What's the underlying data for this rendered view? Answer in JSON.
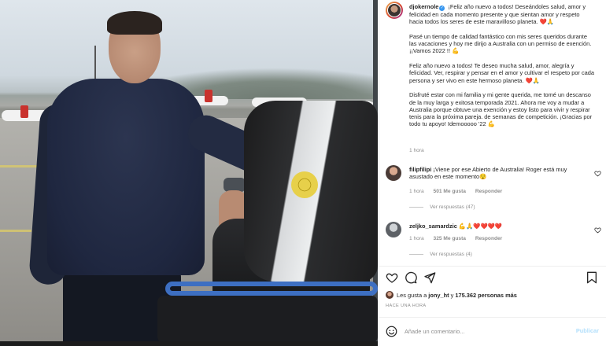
{
  "post": {
    "username": "djokernole",
    "caption_paragraphs": [
      "¡Feliz año nuevo a todos! Deseándoles salud, amor y felicidad en cada momento presente y que sientan amor y respeto hacia todos los seres de este maravilloso planeta. ❤️🙏",
      "Pasé un tiempo de calidad fantástico con mis seres queridos durante las vacaciones y hoy me dirijo a Australia con un permiso de exención. ¡¡Vamos 2022 !! 💪",
      "Feliz año nuevo a todos! Te deseo mucha salud, amor, alegría y felicidad. Ver, respirar y pensar en el amor y cultivar el respeto por cada persona y ser vivo en este hermoso planeta. ❤️🙏",
      "Disfruté estar con mi familia y mi gente querida, me tomé un descanso de la muy larga y exitosa temporada 2021. Ahora me voy a mudar a Australia porque obtuve una exención y estoy listo para vivir y respirar tenis para la próxima pareja. de semanas de competición. ¡Gracias por todo tu apoyo! Idemooooo '22 💪"
    ],
    "time": "1 hora"
  },
  "comments": [
    {
      "username": "filipfilipi",
      "text": "¡Viene por ese Abierto de Australia! Roger está muy asustado en este momento😯",
      "time": "1 hora",
      "likes": "501 Me gusta",
      "reply_label": "Responder",
      "view_replies": "Ver respuestas (47)"
    },
    {
      "username": "zeljko_samardzic",
      "text": "💪🙏❤️❤️❤️❤️",
      "time": "1 hora",
      "likes": "325 Me gusta",
      "reply_label": "Responder",
      "view_replies": "Ver respuestas (4)"
    }
  ],
  "actions": {
    "likes_prefix": "Les gusta a",
    "likes_user": "jony_ht",
    "likes_connector": "y",
    "likes_count": "175.362 personas más",
    "time_ago": "HACE UNA HORA"
  },
  "add_comment": {
    "placeholder": "Añade un comentario...",
    "publish_label": "Publicar"
  },
  "colors": {
    "accent": "#3897f0",
    "publish_disabled": "#b2dffc",
    "heart": "#ed4956",
    "muted": "#8e8e8e"
  },
  "icons": [
    "heart-icon",
    "comment-icon",
    "share-icon",
    "bookmark-icon",
    "smile-icon",
    "verified-icon"
  ]
}
